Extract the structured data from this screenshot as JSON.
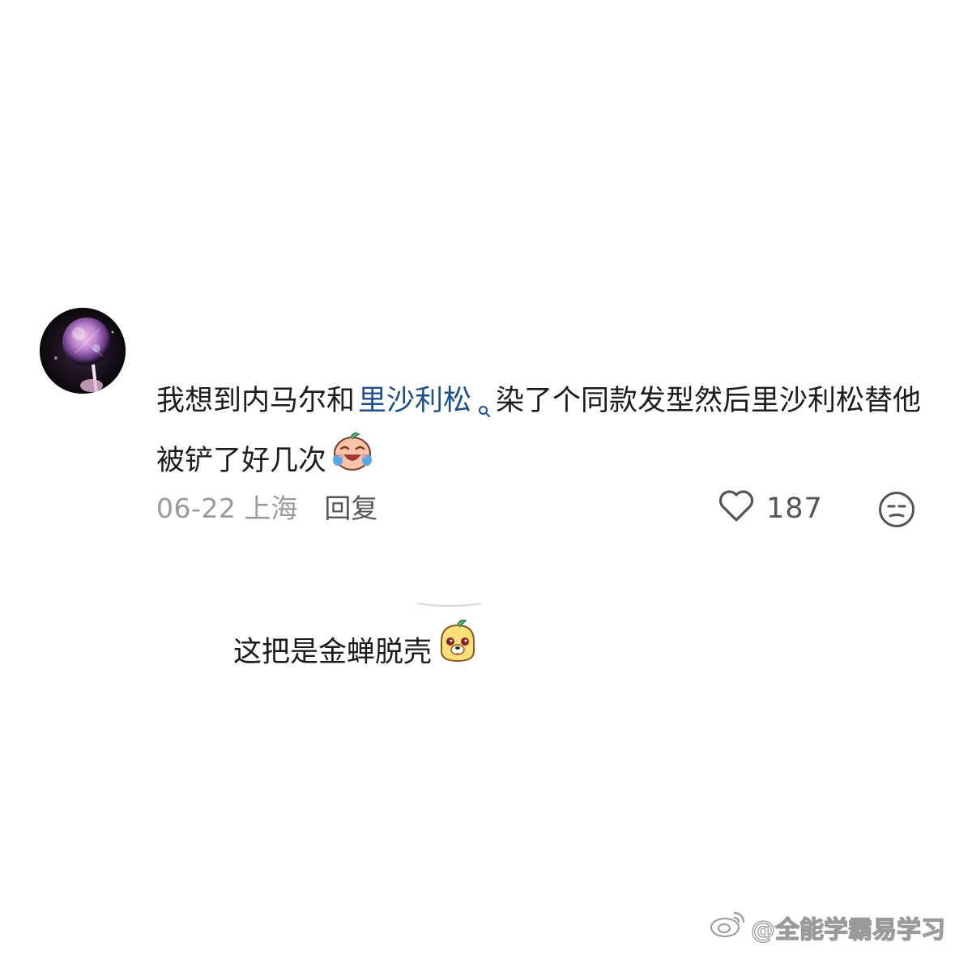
{
  "comment": {
    "avatar_icon": "lollipop-avatar",
    "text_part1": "我想到内马尔和",
    "link_term": "里沙利松",
    "text_part2": "染了个同款发型然后里沙利松替他被铲了好几次",
    "emoji": "crying-laughing-emoji",
    "date": "06-22",
    "location": "上海",
    "reply_label": "回复",
    "like_count": "187",
    "link_color": "#1d4f8c"
  },
  "reply": {
    "text": "这把是金蝉脱壳",
    "emoji": "cheeky-dog-emoji"
  },
  "watermark": {
    "text": "@全能学霸易学习",
    "icon": "weibo-icon"
  }
}
